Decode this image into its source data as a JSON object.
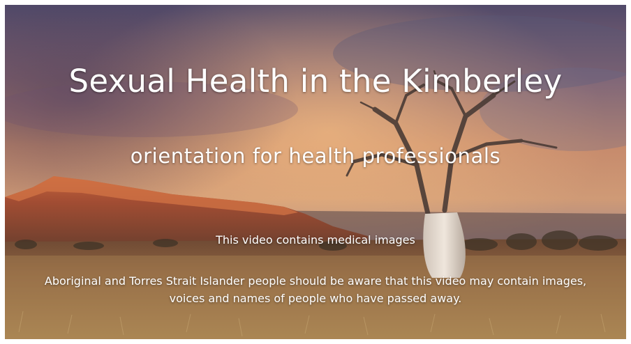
{
  "video": {
    "title": "Sexual Health in the Kimberley",
    "subtitle": "orientation for health professionals",
    "notice_medical": "This video contains medical images",
    "notice_warning": "Aboriginal and Torres Strait Islander people should be aware that this video may contain images, voices and names of people who have passed away."
  },
  "background": {
    "scene": "outback-sunset-landscape",
    "features": [
      "escarpment",
      "boab-tree",
      "grassland"
    ],
    "colors": {
      "sky_top": "#4f4b6b",
      "sky_mid": "#b9806a",
      "sky_glow": "#e3a775",
      "land": "#7c5535",
      "grass": "#a8824e"
    }
  }
}
